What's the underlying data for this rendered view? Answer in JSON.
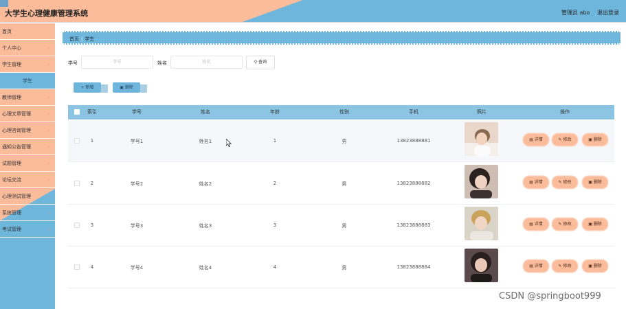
{
  "header": {
    "title": "大学生心理健康管理系统",
    "user": "管理员 abo",
    "logout": "退出登录"
  },
  "sidebar": {
    "items": [
      {
        "label": "首页",
        "has_caret": false
      },
      {
        "label": "个人中心",
        "has_caret": true
      },
      {
        "label": "学生管理",
        "has_caret": true
      },
      {
        "label": "学生",
        "sub": true
      },
      {
        "label": "教师管理",
        "has_caret": true
      },
      {
        "label": "心理文章管理",
        "has_caret": true
      },
      {
        "label": "心理咨询管理",
        "has_caret": true
      },
      {
        "label": "通知公告管理",
        "has_caret": true
      },
      {
        "label": "试题管理",
        "has_caret": true
      },
      {
        "label": "论坛交流",
        "has_caret": true
      },
      {
        "label": "心理测试管理",
        "has_caret": true
      },
      {
        "label": "系统管理",
        "has_caret": true
      },
      {
        "label": "考试管理",
        "has_caret": true
      }
    ],
    "caret_glyph": "⌄"
  },
  "breadcrumb": {
    "home": "首页",
    "current": "学生"
  },
  "filters": {
    "student_no_label": "学号",
    "student_no_placeholder": "学号",
    "name_label": "姓名",
    "name_placeholder": "姓名",
    "query_label": "查询",
    "query_icon": "search-icon"
  },
  "actions": {
    "add_label": "新增",
    "delete_label": "删除"
  },
  "table": {
    "columns": [
      "索引",
      "学号",
      "姓名",
      "年龄",
      "性别",
      "手机",
      "照片",
      "操作"
    ],
    "rows": [
      {
        "index": "1",
        "student_no": "学号1",
        "name": "姓名1",
        "age": "1",
        "gender": "男",
        "phone": "13823888881"
      },
      {
        "index": "2",
        "student_no": "学号2",
        "name": "姓名2",
        "age": "2",
        "gender": "男",
        "phone": "13823888882"
      },
      {
        "index": "3",
        "student_no": "学号3",
        "name": "姓名3",
        "age": "3",
        "gender": "男",
        "phone": "13823888883"
      },
      {
        "index": "4",
        "student_no": "学号4",
        "name": "姓名4",
        "age": "4",
        "gender": "男",
        "phone": "13823888884"
      }
    ],
    "row_ops": {
      "detail": "详情",
      "edit": "修改",
      "delete": "删除"
    }
  },
  "watermark": "CSDN @springboot999",
  "colors": {
    "peach": "#fbbc9b",
    "blue": "#6fb6dd",
    "table_header": "#8cc5e4"
  }
}
